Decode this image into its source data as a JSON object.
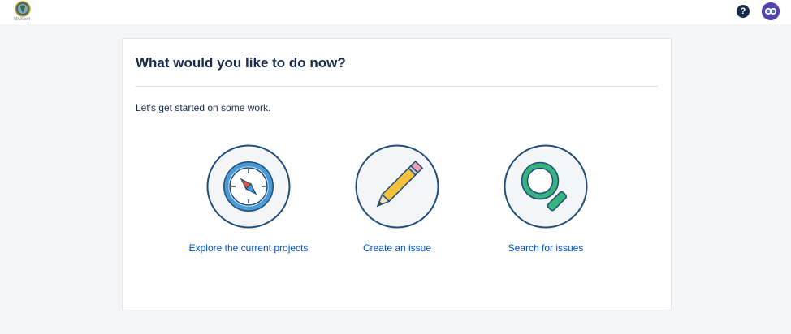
{
  "header": {
    "logo_text": "MAXsoft",
    "help_icon": "question-circle-icon",
    "avatar_icon": "user-avatar"
  },
  "colors": {
    "background": "#f4f5f7",
    "link": "#0052cc",
    "heading": "#172b4d",
    "icon_outline": "#1f4e79",
    "icon_fill": "#f4f5f7"
  },
  "card": {
    "title": "What would you like to do now?",
    "intro": "Let's get started on some work.",
    "options": [
      {
        "label": "Explore the current projects",
        "icon": "compass-icon"
      },
      {
        "label": "Create an issue",
        "icon": "pencil-icon"
      },
      {
        "label": "Search for issues",
        "icon": "magnifier-icon"
      }
    ]
  }
}
